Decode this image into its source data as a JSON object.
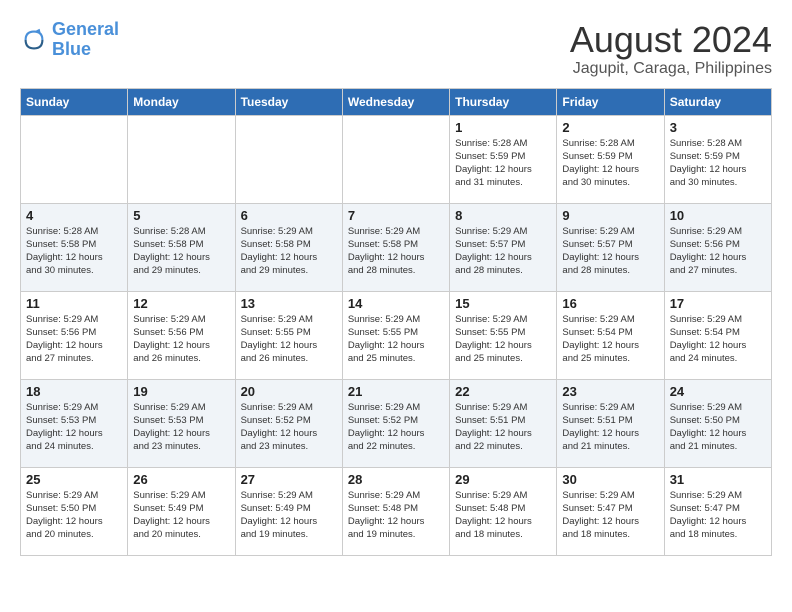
{
  "logo": {
    "line1": "General",
    "line2": "Blue"
  },
  "title": "August 2024",
  "subtitle": "Jagupit, Caraga, Philippines",
  "days_of_week": [
    "Sunday",
    "Monday",
    "Tuesday",
    "Wednesday",
    "Thursday",
    "Friday",
    "Saturday"
  ],
  "weeks": [
    [
      {
        "day": "",
        "info": ""
      },
      {
        "day": "",
        "info": ""
      },
      {
        "day": "",
        "info": ""
      },
      {
        "day": "",
        "info": ""
      },
      {
        "day": "1",
        "info": "Sunrise: 5:28 AM\nSunset: 5:59 PM\nDaylight: 12 hours\nand 31 minutes."
      },
      {
        "day": "2",
        "info": "Sunrise: 5:28 AM\nSunset: 5:59 PM\nDaylight: 12 hours\nand 30 minutes."
      },
      {
        "day": "3",
        "info": "Sunrise: 5:28 AM\nSunset: 5:59 PM\nDaylight: 12 hours\nand 30 minutes."
      }
    ],
    [
      {
        "day": "4",
        "info": "Sunrise: 5:28 AM\nSunset: 5:58 PM\nDaylight: 12 hours\nand 30 minutes."
      },
      {
        "day": "5",
        "info": "Sunrise: 5:28 AM\nSunset: 5:58 PM\nDaylight: 12 hours\nand 29 minutes."
      },
      {
        "day": "6",
        "info": "Sunrise: 5:29 AM\nSunset: 5:58 PM\nDaylight: 12 hours\nand 29 minutes."
      },
      {
        "day": "7",
        "info": "Sunrise: 5:29 AM\nSunset: 5:58 PM\nDaylight: 12 hours\nand 28 minutes."
      },
      {
        "day": "8",
        "info": "Sunrise: 5:29 AM\nSunset: 5:57 PM\nDaylight: 12 hours\nand 28 minutes."
      },
      {
        "day": "9",
        "info": "Sunrise: 5:29 AM\nSunset: 5:57 PM\nDaylight: 12 hours\nand 28 minutes."
      },
      {
        "day": "10",
        "info": "Sunrise: 5:29 AM\nSunset: 5:56 PM\nDaylight: 12 hours\nand 27 minutes."
      }
    ],
    [
      {
        "day": "11",
        "info": "Sunrise: 5:29 AM\nSunset: 5:56 PM\nDaylight: 12 hours\nand 27 minutes."
      },
      {
        "day": "12",
        "info": "Sunrise: 5:29 AM\nSunset: 5:56 PM\nDaylight: 12 hours\nand 26 minutes."
      },
      {
        "day": "13",
        "info": "Sunrise: 5:29 AM\nSunset: 5:55 PM\nDaylight: 12 hours\nand 26 minutes."
      },
      {
        "day": "14",
        "info": "Sunrise: 5:29 AM\nSunset: 5:55 PM\nDaylight: 12 hours\nand 25 minutes."
      },
      {
        "day": "15",
        "info": "Sunrise: 5:29 AM\nSunset: 5:55 PM\nDaylight: 12 hours\nand 25 minutes."
      },
      {
        "day": "16",
        "info": "Sunrise: 5:29 AM\nSunset: 5:54 PM\nDaylight: 12 hours\nand 25 minutes."
      },
      {
        "day": "17",
        "info": "Sunrise: 5:29 AM\nSunset: 5:54 PM\nDaylight: 12 hours\nand 24 minutes."
      }
    ],
    [
      {
        "day": "18",
        "info": "Sunrise: 5:29 AM\nSunset: 5:53 PM\nDaylight: 12 hours\nand 24 minutes."
      },
      {
        "day": "19",
        "info": "Sunrise: 5:29 AM\nSunset: 5:53 PM\nDaylight: 12 hours\nand 23 minutes."
      },
      {
        "day": "20",
        "info": "Sunrise: 5:29 AM\nSunset: 5:52 PM\nDaylight: 12 hours\nand 23 minutes."
      },
      {
        "day": "21",
        "info": "Sunrise: 5:29 AM\nSunset: 5:52 PM\nDaylight: 12 hours\nand 22 minutes."
      },
      {
        "day": "22",
        "info": "Sunrise: 5:29 AM\nSunset: 5:51 PM\nDaylight: 12 hours\nand 22 minutes."
      },
      {
        "day": "23",
        "info": "Sunrise: 5:29 AM\nSunset: 5:51 PM\nDaylight: 12 hours\nand 21 minutes."
      },
      {
        "day": "24",
        "info": "Sunrise: 5:29 AM\nSunset: 5:50 PM\nDaylight: 12 hours\nand 21 minutes."
      }
    ],
    [
      {
        "day": "25",
        "info": "Sunrise: 5:29 AM\nSunset: 5:50 PM\nDaylight: 12 hours\nand 20 minutes."
      },
      {
        "day": "26",
        "info": "Sunrise: 5:29 AM\nSunset: 5:49 PM\nDaylight: 12 hours\nand 20 minutes."
      },
      {
        "day": "27",
        "info": "Sunrise: 5:29 AM\nSunset: 5:49 PM\nDaylight: 12 hours\nand 19 minutes."
      },
      {
        "day": "28",
        "info": "Sunrise: 5:29 AM\nSunset: 5:48 PM\nDaylight: 12 hours\nand 19 minutes."
      },
      {
        "day": "29",
        "info": "Sunrise: 5:29 AM\nSunset: 5:48 PM\nDaylight: 12 hours\nand 18 minutes."
      },
      {
        "day": "30",
        "info": "Sunrise: 5:29 AM\nSunset: 5:47 PM\nDaylight: 12 hours\nand 18 minutes."
      },
      {
        "day": "31",
        "info": "Sunrise: 5:29 AM\nSunset: 5:47 PM\nDaylight: 12 hours\nand 18 minutes."
      }
    ]
  ]
}
